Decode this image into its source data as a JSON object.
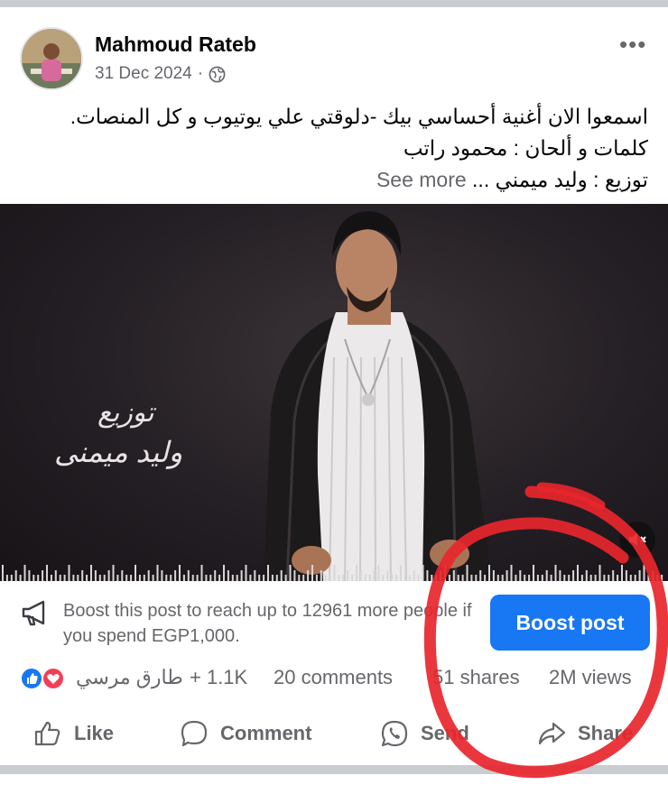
{
  "post": {
    "author": "Mahmoud Rateb",
    "date": "31 Dec 2024",
    "dot": "·",
    "privacy_icon": "globe-icon",
    "more_icon": "more-options-icon",
    "more_glyph": "•••",
    "text_lines": [
      "اسمعوا الان أغنية أحساسي بيك -دلوقتي علي يوتيوب و كل المنصات.",
      "كلمات و ألحان : محمود راتب",
      "توزيع : وليد ميمني ..."
    ],
    "see_more": "See more"
  },
  "media": {
    "overlay_line1": "توزيع",
    "overlay_line2": "وليد ميمنى",
    "mute_icon": "muted-speaker-icon",
    "muted": true
  },
  "boost": {
    "text": "Boost this post to reach up to 12961 more people if you spend EGP1,000.",
    "button_label": "Boost post",
    "icon": "megaphone-icon"
  },
  "stats": {
    "reactions": [
      "like-reaction-icon",
      "love-reaction-icon"
    ],
    "reactors": "طارق مرسي",
    "reactors_count": "+ 1.1K",
    "comments": "20 comments",
    "shares": "51 shares",
    "views": "2M views"
  },
  "actions": {
    "like": "Like",
    "comment": "Comment",
    "send": "Send",
    "share": "Share"
  },
  "colors": {
    "accent": "#1877f2",
    "muted_text": "#65676b",
    "annotation": "#e8262c",
    "love": "#f33e58"
  }
}
